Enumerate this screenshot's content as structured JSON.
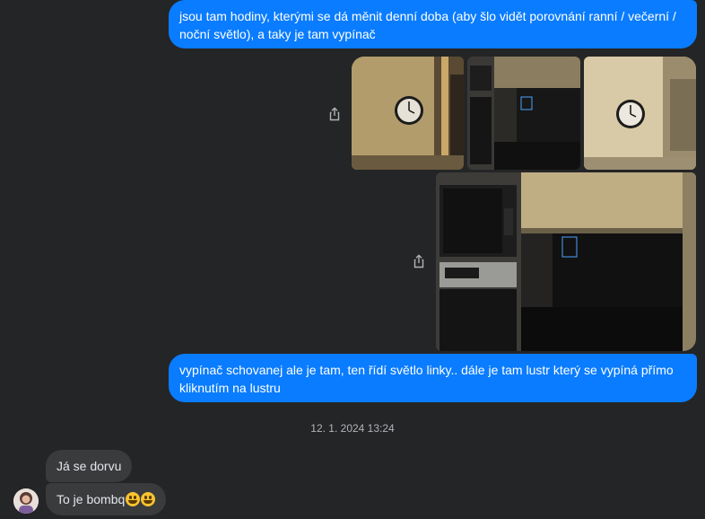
{
  "conversation": {
    "messages_out": [
      {
        "text": "jsou tam hodiny, kterými se dá měnit denní doba (aby šlo vidět porovnání ranní / večerní / noční světlo), a taky je tam vypínač"
      },
      {
        "text": "vypínač schovanej ale je tam, ten řídí světlo linky.. dále je tam lustr který se vypíná přímo kliknutím na lustru"
      }
    ],
    "timestamp": "12. 1. 2024 13:24",
    "messages_in": [
      {
        "text": "Já se dorvu"
      },
      {
        "text": "To je bombq"
      }
    ]
  },
  "icons": {
    "share": "share-icon",
    "emoji": "grinning-face-icon"
  },
  "colors": {
    "background": "#242526",
    "outgoing_bubble": "#0a7cff",
    "incoming_bubble": "#3a3b3c",
    "timestamp": "#b0b3b8"
  }
}
